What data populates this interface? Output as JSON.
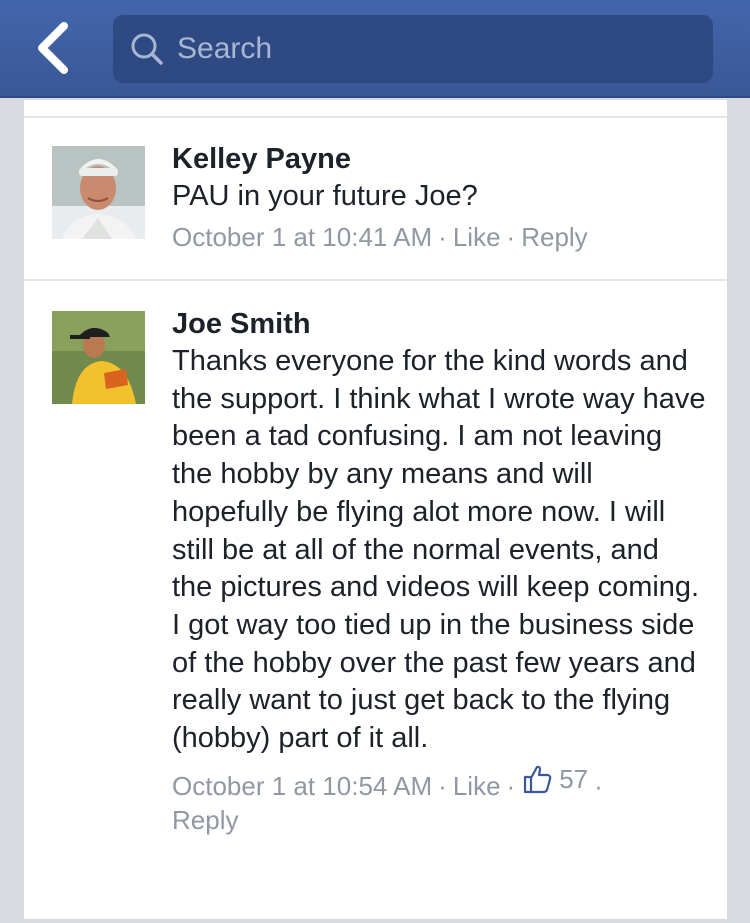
{
  "header": {
    "back_icon": "chevron-left-icon",
    "search": {
      "placeholder": "Search",
      "icon": "search-icon"
    },
    "colors": {
      "bar": "#3b5998",
      "search_box": "#2f4a83"
    }
  },
  "comments": [
    {
      "author": "Kelley Payne",
      "text": "PAU in your future Joe?",
      "timestamp": "October 1 at 10:41 AM",
      "like_label": "Like",
      "reply_label": "Reply",
      "separator": "·"
    },
    {
      "author": "Joe Smith",
      "text": "Thanks everyone for the kind words and the support. I think what I wrote way have been a tad confusing. I am not leaving the hobby by any means and will hopefully be flying alot more now. I will still be at all of the normal events, and the pictures and videos will keep coming. I got way too tied up in the business side of the hobby over the past few years and really want to just get back to the flying (hobby) part of it all.",
      "timestamp": "October 1 at 10:54 AM",
      "like_label": "Like",
      "like_count": "57",
      "like_icon": "thumbs-up-icon",
      "reply_label": "Reply",
      "separator": "·"
    }
  ]
}
